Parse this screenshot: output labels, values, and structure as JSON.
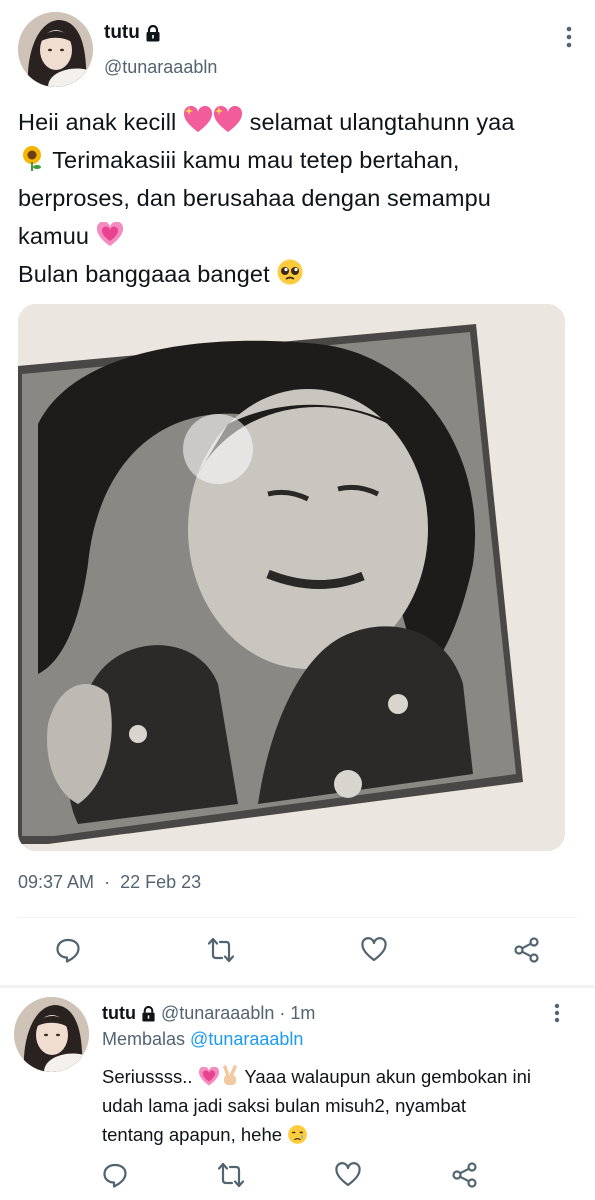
{
  "tweet": {
    "display_name": "tutu",
    "handle": "@tunaraaabln",
    "text_lines": [
      [
        "Heii anak kecill ",
        " selamat ulangtahunn yaa"
      ],
      [
        " Terimakasiii kamu mau tetep bertahan,"
      ],
      [
        "berproses, dan berusahaa dengan semampu"
      ],
      [
        "kamuu "
      ],
      [
        "Bulan banggaaa banget "
      ]
    ],
    "time": "09:37 AM",
    "dot": "·",
    "date": "22 Feb 23"
  },
  "reply": {
    "display_name": "tutu",
    "handle": "@tunaraaabln",
    "dot": "·",
    "age": "1m",
    "replying_label": "Membalas",
    "replying_to": "@tunaraaabln",
    "text_lines": [
      [
        "Seriussss.. ",
        " Yaaa walaupun akun gembokan ini"
      ],
      [
        "udah lama jadi saksi bulan misuh2, nyambat"
      ],
      [
        "tentang apapun, hehe "
      ]
    ]
  },
  "icons": {
    "lock": "lock-icon",
    "more": "more-vertical-icon",
    "reply": "reply-icon",
    "retweet": "retweet-icon",
    "like": "heart-icon",
    "share": "share-icon"
  },
  "colors": {
    "text": "#0f1419",
    "secondary": "#536471",
    "link": "#1d9bf0",
    "divider": "#eff3f4",
    "icon": "#536471"
  }
}
